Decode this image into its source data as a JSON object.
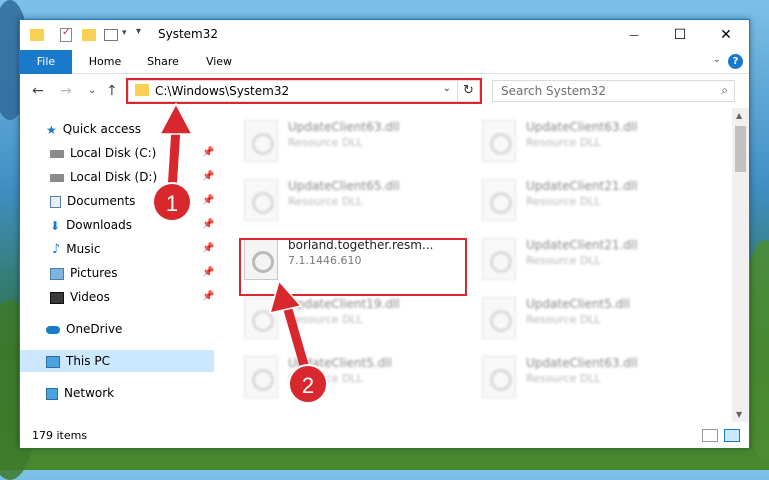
{
  "window": {
    "title": "System32",
    "minimize_glyph": "—",
    "maximize_glyph": "☐",
    "close_glyph": "✕"
  },
  "ribbon": {
    "tabs": [
      "File",
      "Home",
      "Share",
      "View"
    ],
    "help_glyph": "?",
    "collapse_glyph": "⌄"
  },
  "nav": {
    "back_glyph": "←",
    "forward_glyph": "→",
    "recent_glyph": "⌄",
    "up_glyph": "↑",
    "address": "C:\\Windows\\System32",
    "search_placeholder": "Search System32"
  },
  "sidebar": {
    "items": [
      {
        "label": "Quick access",
        "icon": "star-icon",
        "pinned": false
      },
      {
        "label": "Local Disk (C:)",
        "icon": "drive-icon",
        "pinned": true
      },
      {
        "label": "Local Disk (D:)",
        "icon": "drive-icon",
        "pinned": true
      },
      {
        "label": "Documents",
        "icon": "documents-icon",
        "pinned": true
      },
      {
        "label": "Downloads",
        "icon": "downloads-icon",
        "pinned": true
      },
      {
        "label": "Music",
        "icon": "music-icon",
        "pinned": true
      },
      {
        "label": "Pictures",
        "icon": "pictures-icon",
        "pinned": true
      },
      {
        "label": "Videos",
        "icon": "videos-icon",
        "pinned": true
      },
      {
        "label": "OneDrive",
        "icon": "cloud-icon",
        "pinned": false
      },
      {
        "label": "This PC",
        "icon": "computer-icon",
        "pinned": false,
        "selected": true
      },
      {
        "label": "Network",
        "icon": "network-icon",
        "pinned": false
      }
    ]
  },
  "files": [
    {
      "name": "UpdateClient63.dll",
      "sub": "Resource DLL"
    },
    {
      "name": "UpdateClient63.dll",
      "sub": "Resource DLL"
    },
    {
      "name": "UpdateClient65.dll",
      "sub": "Resource DLL"
    },
    {
      "name": "UpdateClient21.dll",
      "sub": "Resource DLL"
    },
    {
      "name": "borland.together.resm...",
      "sub": "7.1.1446.610"
    },
    {
      "name": "UpdateClient21.dll",
      "sub": "Resource DLL"
    },
    {
      "name": "UpdateClient19.dll",
      "sub": "Resource DLL"
    },
    {
      "name": "UpdateClient5.dll",
      "sub": "Resource DLL"
    },
    {
      "name": "UpdateClient5.dll",
      "sub": "Resource DLL"
    },
    {
      "name": "UpdateClient63.dll",
      "sub": "Resource DLL"
    }
  ],
  "status": {
    "item_count": "179 items"
  },
  "annotations": {
    "step1": "1",
    "step2": "2",
    "color": "#d9272e"
  }
}
